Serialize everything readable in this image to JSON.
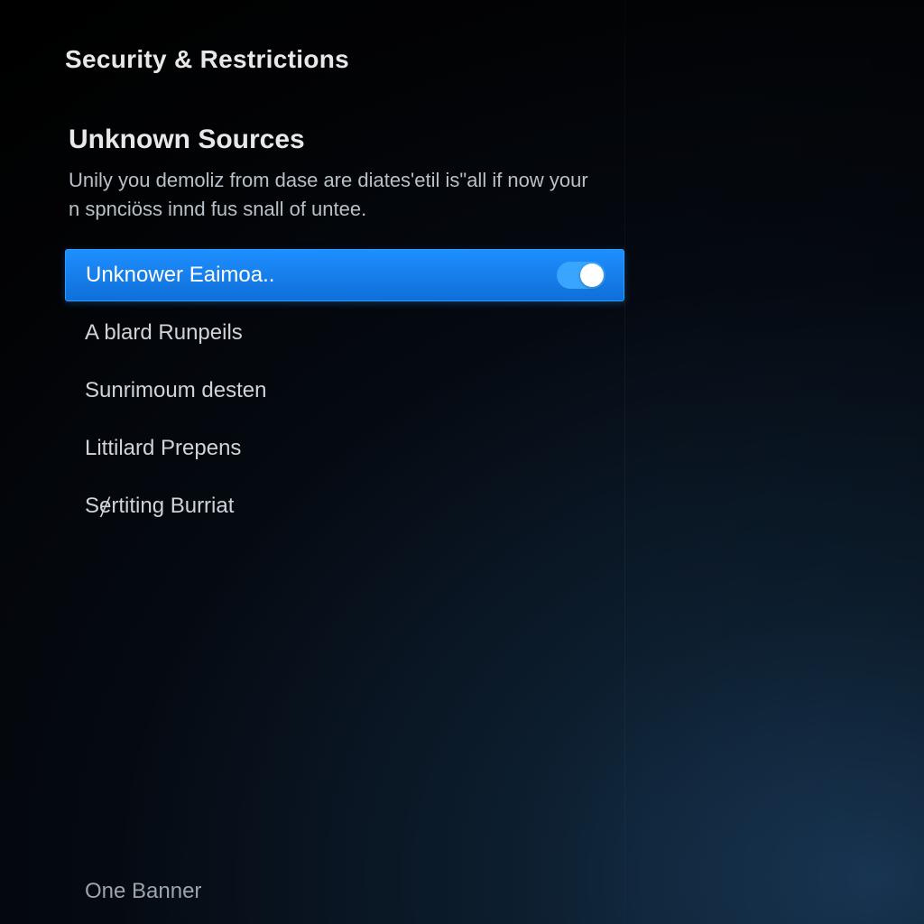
{
  "page_title": "Security & Restrictions",
  "section": {
    "title": "Unknown Sources",
    "description": "Unily you demoliz from dase are diates'etil is\"all if now your n spnciöss innd fus snall of untee."
  },
  "items": [
    {
      "label": "Unknower Eaimoa..",
      "selected": true,
      "toggle_on": true
    },
    {
      "label": "A blard Runpeils",
      "selected": false
    },
    {
      "label": "Sunrimoum desten",
      "selected": false
    },
    {
      "label": "Littilard Prepens",
      "selected": false
    },
    {
      "label": "Sɇrtiting Burriat",
      "selected": false
    }
  ],
  "bottom_label": "One Banner"
}
